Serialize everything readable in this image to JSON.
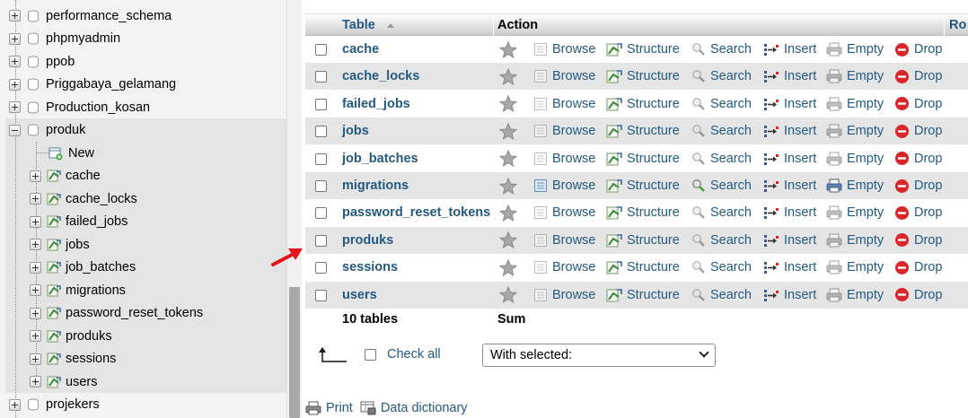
{
  "nav": {
    "databases_top": [
      "performance_schema",
      "phpmyadmin",
      "ppob",
      "Priggabaya_gelamang",
      "Production_kosan"
    ],
    "current_db": "produk",
    "new_label": "New",
    "tables": [
      "cache",
      "cache_locks",
      "failed_jobs",
      "jobs",
      "job_batches",
      "migrations",
      "password_reset_tokens",
      "produks",
      "sessions",
      "users"
    ],
    "databases_bottom": [
      "projekers"
    ]
  },
  "table": {
    "headers": {
      "table": "Table",
      "action": "Action",
      "rows_partial": "Ro"
    },
    "actions": {
      "browse": "Browse",
      "structure": "Structure",
      "search": "Search",
      "insert": "Insert",
      "empty": "Empty",
      "drop": "Drop"
    },
    "rows": [
      {
        "name": "cache"
      },
      {
        "name": "cache_locks"
      },
      {
        "name": "failed_jobs"
      },
      {
        "name": "jobs"
      },
      {
        "name": "job_batches"
      },
      {
        "name": "migrations"
      },
      {
        "name": "password_reset_tokens"
      },
      {
        "name": "produks"
      },
      {
        "name": "sessions"
      },
      {
        "name": "users"
      }
    ],
    "summary": {
      "count_label": "10 tables",
      "sum_label": "Sum"
    }
  },
  "bulk": {
    "check_all": "Check all",
    "with_selected": "With selected:"
  },
  "footer": {
    "print": "Print",
    "data_dictionary": "Data dictionary"
  },
  "colors": {
    "link": "#235a81",
    "row_alt": "#e5e5e5",
    "drop_red": "#d9262b",
    "pointer_red": "#e5141b"
  }
}
